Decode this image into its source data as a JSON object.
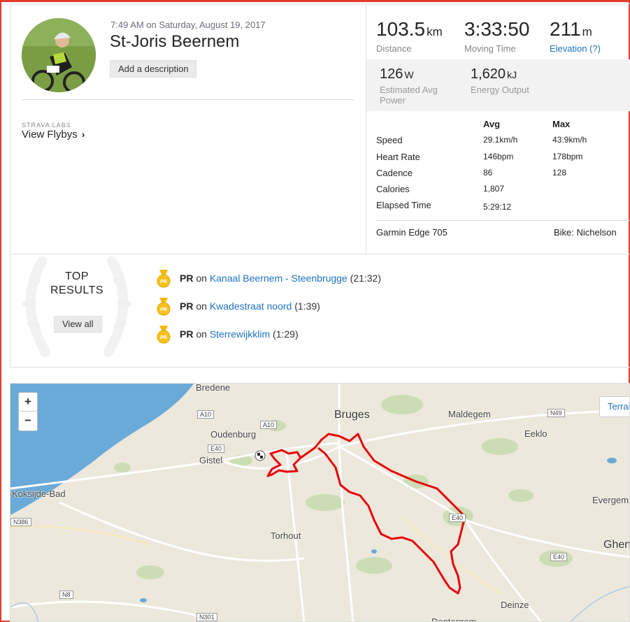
{
  "activity": {
    "datetime": "7:49 AM on Saturday, August 19, 2017",
    "title": "St-Joris Beernem",
    "add_description_label": "Add a description",
    "labs_caption": "STRAVA LABS",
    "flybys_label": "View Flybys"
  },
  "stats": {
    "distance": {
      "value": "103.5",
      "unit": "km",
      "label": "Distance"
    },
    "moving_time": {
      "value": "3:33:50",
      "label": "Moving Time"
    },
    "elevation": {
      "value": "211",
      "unit": "m",
      "label": "Elevation (?)"
    },
    "power": {
      "value": "126",
      "unit": "W",
      "label": "Estimated Avg Power"
    },
    "energy": {
      "value": "1,620",
      "unit": "kJ",
      "label": "Energy Output"
    },
    "table": {
      "avg_header": "Avg",
      "max_header": "Max",
      "rows": [
        {
          "label": "Speed",
          "avg": "29.1km/h",
          "max": "43.9km/h"
        },
        {
          "label": "Heart Rate",
          "avg": "146bpm",
          "max": "178bpm"
        },
        {
          "label": "Cadence",
          "avg": "86",
          "max": "128"
        },
        {
          "label": "Calories",
          "avg": "1,807",
          "max": ""
        },
        {
          "label": "Elapsed Time",
          "avg": "5:29:12",
          "max": ""
        }
      ]
    },
    "device": "Garmin Edge 705",
    "bike": "Bike: Nichelson"
  },
  "results": {
    "heading": "TOP RESULTS",
    "view_all_label": "View all",
    "medal_text": "PR",
    "items": [
      {
        "badge": "PR",
        "on": "on",
        "segment": "Kanaal Beernem - Steenbrugge",
        "time": "(21:32)"
      },
      {
        "badge": "PR",
        "on": "on",
        "segment": "Kwadestraat noord",
        "time": "(1:39)"
      },
      {
        "badge": "PR",
        "on": "on",
        "segment": "Sterrewijkklim",
        "time": "(1:29)"
      }
    ]
  },
  "map": {
    "zoom_in": "+",
    "zoom_out": "−",
    "terrain_label": "Terrain",
    "places": [
      "Bredene",
      "Bruges",
      "Maldegem",
      "Eeklo",
      "Oudenburg",
      "Gistel",
      "Koksijde-Bad",
      "Torhout",
      "Evergem",
      "Ghent",
      "Deinze",
      "Dentergem"
    ],
    "road_shields": [
      "A10",
      "A10",
      "E40",
      "N49",
      "E40",
      "E40",
      "N386",
      "N8",
      "N301"
    ],
    "route_color": "#e8000b",
    "sea_color": "#6aaad8"
  }
}
